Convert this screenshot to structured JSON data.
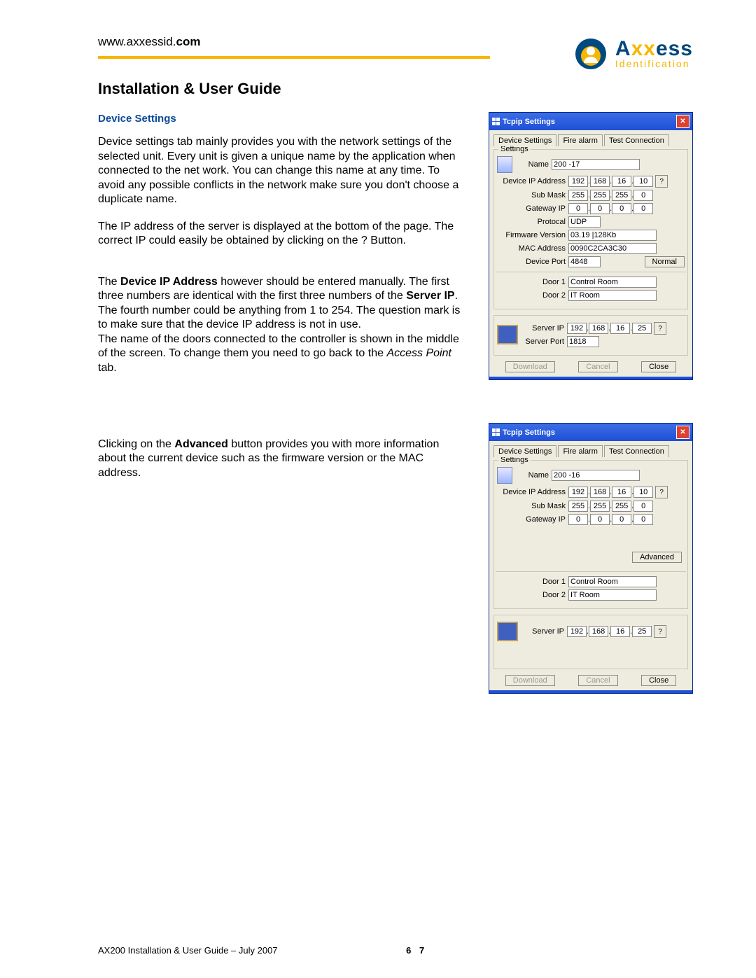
{
  "header": {
    "url_prefix": "www.axxessid.",
    "url_bold": "com"
  },
  "logo": {
    "main": "Axxess",
    "sub": "Identification"
  },
  "title": "Installation & User Guide",
  "section_title": "Device Settings",
  "paragraphs": {
    "p1": "Device settings tab mainly provides you with the network settings of the selected unit. Every unit is given a unique name by the application when connected to the net work. You can change this name at any time. To avoid any possible conflicts in the network make sure you don't choose a duplicate name.",
    "p2": "The IP address of the server is displayed at the bottom of the page. The correct IP could easily be obtained by clicking on the ? Button.",
    "p3_a": "The ",
    "p3_b": "Device IP Address",
    "p3_c": " however should be entered manually. The first three numbers are identical with the first three numbers of the ",
    "p3_d": "Server IP",
    "p3_e": ". The fourth number could be anything from 1 to 254. The question mark is to make sure that the device IP address is not in use.\nThe name of the doors connected to the controller is shown in the middle of the screen. To change them you need to go back to the ",
    "p3_f": "Access Point",
    "p3_g": " tab.",
    "p4_a": "Clicking on the ",
    "p4_b": "Advanced",
    "p4_c": " button provides you with more information about the current device such as the firmware version or the MAC address."
  },
  "dialog1": {
    "title": "Tcpip Settings",
    "tabs": [
      "Device Settings",
      "Fire alarm",
      "Test Connection"
    ],
    "settings_legend": "Settings",
    "labels": {
      "name": "Name",
      "dev_ip": "Device IP Address",
      "sub": "Sub Mask",
      "gw": "Gateway IP",
      "proto": "Protocal",
      "fw": "Firmware Version",
      "mac": "MAC Address",
      "port": "Device Port",
      "d1": "Door 1",
      "d2": "Door 2",
      "srv_ip": "Server IP",
      "srv_port": "Server Port"
    },
    "values": {
      "name": "200 -17",
      "dev_ip": [
        "192",
        "168",
        "16",
        "10"
      ],
      "sub": [
        "255",
        "255",
        "255",
        "0"
      ],
      "gw": [
        "0",
        "0",
        "0",
        "0"
      ],
      "proto": "UDP",
      "fw": "03.19 |128Kb",
      "mac": "0090C2CA3C30",
      "port": "4848",
      "d1": "Control Room",
      "d2": "IT Room",
      "srv_ip": [
        "192",
        "168",
        "16",
        "25"
      ],
      "srv_port": "1818"
    },
    "normal_btn": "Normal",
    "buttons": {
      "download": "Download",
      "cancel": "Cancel",
      "close": "Close"
    },
    "q": "?"
  },
  "dialog2": {
    "title": "Tcpip Settings",
    "tabs": [
      "Device Settings",
      "Fire alarm",
      "Test Connection"
    ],
    "settings_legend": "Settings",
    "labels": {
      "name": "Name",
      "dev_ip": "Device IP Address",
      "sub": "Sub Mask",
      "gw": "Gateway IP",
      "d1": "Door 1",
      "d2": "Door 2",
      "srv_ip": "Server IP"
    },
    "values": {
      "name": "200 -16",
      "dev_ip": [
        "192",
        "168",
        "16",
        "10"
      ],
      "sub": [
        "255",
        "255",
        "255",
        "0"
      ],
      "gw": [
        "0",
        "0",
        "0",
        "0"
      ],
      "d1": "Control Room",
      "d2": "IT Room",
      "srv_ip": [
        "192",
        "168",
        "16",
        "25"
      ]
    },
    "advanced_btn": "Advanced",
    "buttons": {
      "download": "Download",
      "cancel": "Cancel",
      "close": "Close"
    },
    "q": "?"
  },
  "footer": {
    "text": "AX200 Installation & User Guide – July 2007",
    "page": "6 7"
  }
}
